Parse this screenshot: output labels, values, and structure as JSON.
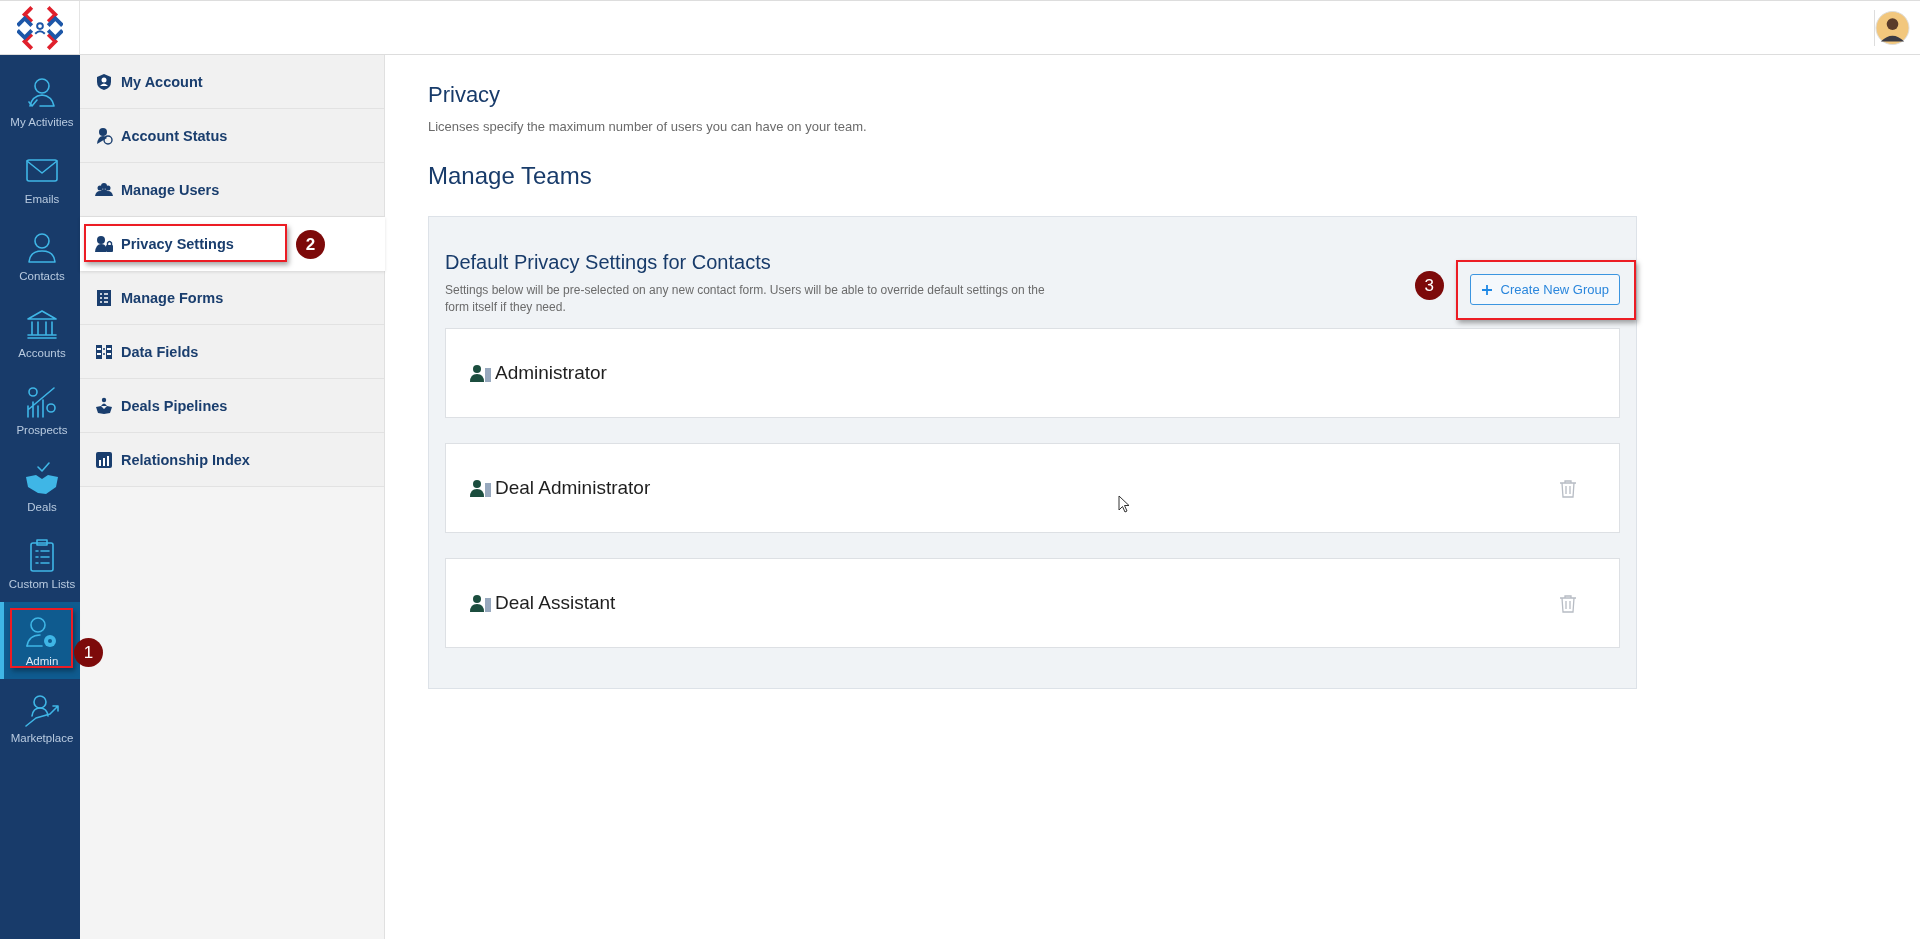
{
  "rail": [
    {
      "label": "My Activities",
      "selected": false
    },
    {
      "label": "Emails",
      "selected": false
    },
    {
      "label": "Contacts",
      "selected": false
    },
    {
      "label": "Accounts",
      "selected": false
    },
    {
      "label": "Prospects",
      "selected": false
    },
    {
      "label": "Deals",
      "selected": false
    },
    {
      "label": "Custom Lists",
      "selected": false
    },
    {
      "label": "Admin",
      "selected": true,
      "callout": "1"
    },
    {
      "label": "Marketplace",
      "selected": false
    }
  ],
  "settings_menu": [
    {
      "label": "My Account",
      "selected": false
    },
    {
      "label": "Account Status",
      "selected": false
    },
    {
      "label": "Manage Users",
      "selected": false
    },
    {
      "label": "Privacy Settings",
      "selected": true,
      "callout": "2"
    },
    {
      "label": "Manage Forms",
      "selected": false
    },
    {
      "label": "Data Fields",
      "selected": false
    },
    {
      "label": "Deals Pipelines",
      "selected": false
    },
    {
      "label": "Relationship Index",
      "selected": false
    }
  ],
  "page": {
    "title": "Privacy",
    "subtitle": "Licenses specify the maximum number of users you can have on your team.",
    "section_title": "Manage Teams"
  },
  "panel": {
    "title": "Default Privacy Settings for Contacts",
    "description": "Settings below will be pre-selected on any new contact form. Users will be able to override default settings on the form itself if they need.",
    "create_button": {
      "label": "Create New Group",
      "callout": "3"
    },
    "groups": [
      {
        "name": "Administrator",
        "deletable": false
      },
      {
        "name": "Deal Administrator",
        "deletable": true
      },
      {
        "name": "Deal Assistant",
        "deletable": true
      }
    ]
  }
}
